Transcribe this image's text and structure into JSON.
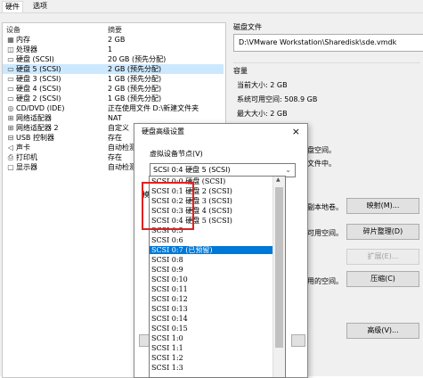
{
  "tabs": [
    "硬件",
    "选项"
  ],
  "devices": {
    "col_device": "设备",
    "col_summary": "摘要",
    "rows": [
      {
        "icon": "memory-icon",
        "glyph": "▦",
        "name": "内存",
        "summary": "2 GB"
      },
      {
        "icon": "cpu-icon",
        "glyph": "◫",
        "name": "处理器",
        "summary": "1"
      },
      {
        "icon": "hard-disk-icon",
        "glyph": "▭",
        "name": "硬盘 (SCSI)",
        "summary": "20 GB (预先分配)"
      },
      {
        "icon": "hard-disk-icon",
        "glyph": "▭",
        "name": "硬盘 5 (SCSI)",
        "summary": "2 GB (预先分配)"
      },
      {
        "icon": "hard-disk-icon",
        "glyph": "▭",
        "name": "硬盘 3 (SCSI)",
        "summary": "1 GB (预先分配)"
      },
      {
        "icon": "hard-disk-icon",
        "glyph": "▭",
        "name": "硬盘 4 (SCSI)",
        "summary": "2 GB (预先分配)"
      },
      {
        "icon": "hard-disk-icon",
        "glyph": "▭",
        "name": "硬盘 2 (SCSI)",
        "summary": "1 GB (预先分配)"
      },
      {
        "icon": "cd-dvd-icon",
        "glyph": "◎",
        "name": "CD/DVD (IDE)",
        "summary": "正在使用文件 D:\\新建文件夹"
      },
      {
        "icon": "network-adapter-icon",
        "glyph": "⊞",
        "name": "网络适配器",
        "summary": "NAT"
      },
      {
        "icon": "network-adapter-icon",
        "glyph": "⊞",
        "name": "网络适配器 2",
        "summary": "自定义"
      },
      {
        "icon": "usb-icon",
        "glyph": "⊟",
        "name": "USB 控制器",
        "summary": "存在"
      },
      {
        "icon": "speaker-icon",
        "glyph": "◁",
        "name": "声卡",
        "summary": "自动检测"
      },
      {
        "icon": "printer-icon",
        "glyph": "⎙",
        "name": "打印机",
        "summary": "存在"
      },
      {
        "icon": "display-icon",
        "glyph": "▢",
        "name": "显示器",
        "summary": "自动检测"
      }
    ]
  },
  "disk_file": {
    "label": "磁盘文件",
    "value": "D:\\VMware Workstation\\Sharedisk\\sde.vmdk"
  },
  "capacity": {
    "label": "容量",
    "current_size": "当前大小: 2 GB",
    "system_free": "系统可用空间: 508.9 GB",
    "max_size": "最大大小: 2 GB"
  },
  "partial_texts": {
    "t1": "盘空间。",
    "t2": "文件中。",
    "t3": "副本地卷。",
    "t4": "可用空间。",
    "t5": "用的空间。"
  },
  "buttons": {
    "map": "映射(M)...",
    "defrag": "碎片整理(D)",
    "expand": "扩展(E)...",
    "compact": "压缩(C)",
    "advanced": "高级(V)..."
  },
  "dialog": {
    "title": "硬盘高级设置",
    "close": "×",
    "node_label": "虚拟设备节点(V)",
    "node_value": "SCSI 0:4  硬盘 5 (SCSI)",
    "combo_arrow": "⌄",
    "cutoff_char": "模"
  },
  "node_list": [
    {
      "text": "SCSI 0:0  硬盘 (SCSI)",
      "hl": false
    },
    {
      "text": "SCSI 0:1  硬盘 2 (SCSI)",
      "hl": false
    },
    {
      "text": "SCSI 0:2  硬盘 3 (SCSI)",
      "hl": false
    },
    {
      "text": "SCSI 0:3  硬盘 4 (SCSI)",
      "hl": false
    },
    {
      "text": "SCSI 0:4  硬盘 5 (SCSI)",
      "hl": false
    },
    {
      "text": "SCSI 0:5",
      "hl": false
    },
    {
      "text": "SCSI 0:6",
      "hl": false
    },
    {
      "text": "SCSI 0:7  (已预留)",
      "hl": true
    },
    {
      "text": "SCSI 0:8",
      "hl": false
    },
    {
      "text": "SCSI 0:9",
      "hl": false
    },
    {
      "text": "SCSI 0:10",
      "hl": false
    },
    {
      "text": "SCSI 0:11",
      "hl": false
    },
    {
      "text": "SCSI 0:12",
      "hl": false
    },
    {
      "text": "SCSI 0:13",
      "hl": false
    },
    {
      "text": "SCSI 0:14",
      "hl": false
    },
    {
      "text": "SCSI 0:15",
      "hl": false
    },
    {
      "text": "SCSI 1:0",
      "hl": false
    },
    {
      "text": "SCSI 1:1",
      "hl": false
    },
    {
      "text": "SCSI 1:2",
      "hl": false
    },
    {
      "text": "SCSI 1:3",
      "hl": false
    }
  ],
  "colors": {
    "selection": "#cce8ff",
    "highlight": "#0078d7",
    "annotation_box": "#e02020"
  }
}
